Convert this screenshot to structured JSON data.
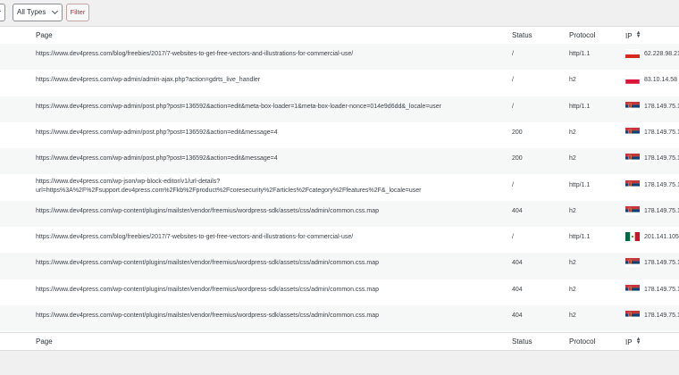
{
  "toolbar": {
    "first_select_value": "",
    "type_select_value": "All Types",
    "filter_label": "Filter"
  },
  "columns": {
    "page": "Page",
    "status": "Status",
    "protocol": "Protocol",
    "ip": "IP"
  },
  "rows": [
    {
      "page": "https://www.dev4press.com/blog/freebies/2017/7-websites-to-get-free-vectors-and-illustrations-for-commercial-use/",
      "status": "/",
      "protocol": "http/1.1",
      "ip": "62.228.98.21",
      "flag": "cyprus"
    },
    {
      "page": "https://www.dev4press.com/wp-admin/admin-ajax.php?action=gdrts_live_handler",
      "status": "/",
      "protocol": "h2",
      "ip": "83.10.14.58",
      "flag": "poland"
    },
    {
      "page": "https://www.dev4press.com/wp-admin/post.php?post=136592&action=edit&meta-box-loader=1&meta-box-loader-nonce=014e9d6dd&_locale=user",
      "status": "/",
      "protocol": "http/1.1",
      "ip": "178.149.75.1",
      "flag": "serbia"
    },
    {
      "page": "https://www.dev4press.com/wp-admin/post.php?post=136592&action=edit&message=4",
      "status": "200",
      "protocol": "h2",
      "ip": "178.149.75.1",
      "flag": "serbia"
    },
    {
      "page": "https://www.dev4press.com/wp-admin/post.php?post=136592&action=edit&message=4",
      "status": "200",
      "protocol": "h2",
      "ip": "178.149.75.1",
      "flag": "serbia"
    },
    {
      "page": "https://www.dev4press.com/wp-json/wp-block-editor/v1/url-details?url=https%3A%2F%2Fsupport.dev4press.com%2Fkb%2Fproduct%2Fcoresecurity%2Farticles%2Fcategory%2Ffeatures%2F&_locale=user",
      "status": "/",
      "protocol": "http/1.1",
      "ip": "178.149.75.1",
      "flag": "serbia"
    },
    {
      "page": "https://www.dev4press.com/wp-content/plugins/mailster/vendor/freemius/wordpress-sdk/assets/css/admin/common.css.map",
      "status": "404",
      "protocol": "h2",
      "ip": "178.149.75.1",
      "flag": "serbia"
    },
    {
      "page": "https://www.dev4press.com/blog/freebies/2017/7-websites-to-get-free-vectors-and-illustrations-for-commercial-use/",
      "status": "/",
      "protocol": "http/1.1",
      "ip": "201.141.105.",
      "flag": "mexico"
    },
    {
      "page": "https://www.dev4press.com/wp-content/plugins/mailster/vendor/freemius/wordpress-sdk/assets/css/admin/common.css.map",
      "status": "404",
      "protocol": "h2",
      "ip": "178.149.75.1",
      "flag": "serbia"
    },
    {
      "page": "https://www.dev4press.com/wp-content/plugins/mailster/vendor/freemius/wordpress-sdk/assets/css/admin/common.css.map",
      "status": "404",
      "protocol": "h2",
      "ip": "178.149.75.1",
      "flag": "serbia"
    },
    {
      "page": "https://www.dev4press.com/wp-content/plugins/mailster/vendor/freemius/wordpress-sdk/assets/css/admin/common.css.map",
      "status": "404",
      "protocol": "h2",
      "ip": "178.149.75.1",
      "flag": "serbia"
    }
  ]
}
